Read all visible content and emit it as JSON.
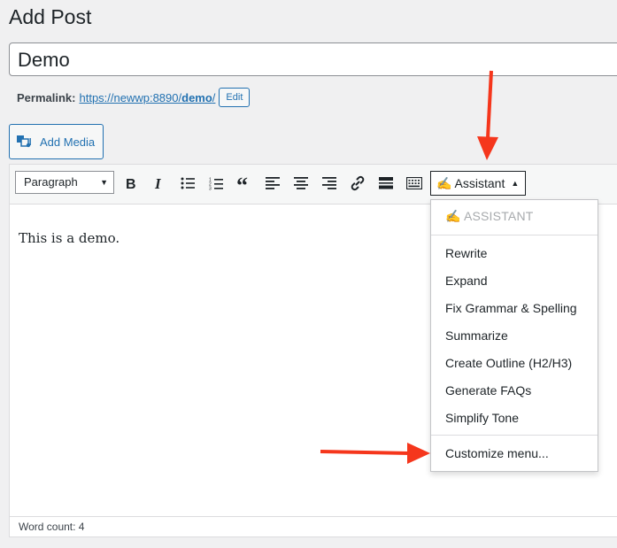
{
  "page": {
    "title": "Add Post"
  },
  "post": {
    "title_value": "Demo"
  },
  "permalink": {
    "label": "Permalink:",
    "url_prefix": "https://newwp:8890/",
    "slug": "demo",
    "url_suffix": "/",
    "edit_label": "Edit"
  },
  "media": {
    "add_label": "Add Media"
  },
  "toolbar": {
    "format_value": "Paragraph",
    "assistant_label": "✍ Assistant",
    "buttons": [
      "bold-icon",
      "italic-icon",
      "bullet-list-icon",
      "numbered-list-icon",
      "blockquote-icon",
      "align-left-icon",
      "align-center-icon",
      "align-right-icon",
      "link-icon",
      "read-more-icon",
      "toolbar-toggle-icon"
    ]
  },
  "editor": {
    "content": "This is a demo."
  },
  "status": {
    "word_count": "Word count: 4"
  },
  "assistant_menu": {
    "header": "✍ ASSISTANT",
    "items": [
      "Rewrite",
      "Expand",
      "Fix Grammar & Spelling",
      "Summarize",
      "Create Outline (H2/H3)",
      "Generate FAQs",
      "Simplify Tone"
    ],
    "footer_item": "Customize menu..."
  },
  "colors": {
    "accent": "#2271b1",
    "annotation_arrow": "#f5361c"
  }
}
